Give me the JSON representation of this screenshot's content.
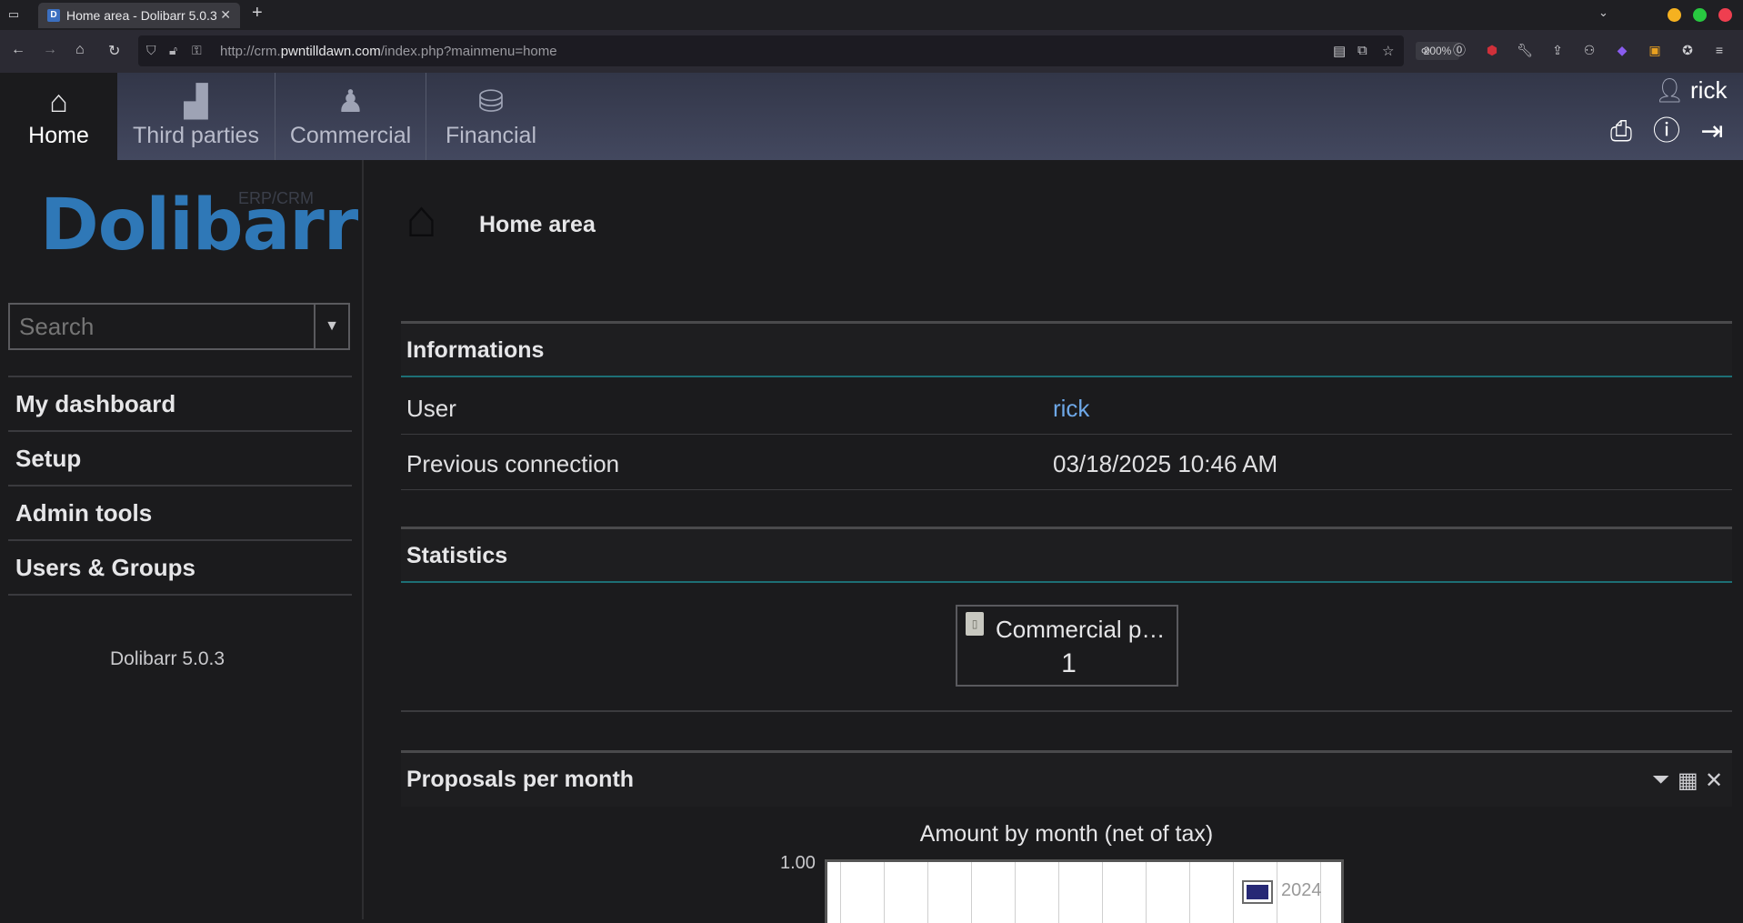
{
  "browser": {
    "tab_title": "Home area - Dolibarr 5.0.3",
    "tab_favicon": "D",
    "url_prefix": "http://crm.",
    "url_domain": "pwntilldawn.com",
    "url_path": "/index.php?mainmenu=home",
    "zoom": "200%"
  },
  "topmenu": {
    "items": [
      {
        "label": "Home",
        "icon": "home-icon"
      },
      {
        "label": "Third parties",
        "icon": "building-icon"
      },
      {
        "label": "Commercial",
        "icon": "salesman-icon"
      },
      {
        "label": "Financial",
        "icon": "coins-icon"
      }
    ],
    "username": "rick"
  },
  "sidebar": {
    "logo_small": "ERP/CRM",
    "logo_word": "Dolibarr",
    "search_placeholder": "Search",
    "items": [
      {
        "label": "My dashboard"
      },
      {
        "label": "Setup"
      },
      {
        "label": "Admin tools"
      },
      {
        "label": "Users & Groups"
      }
    ],
    "version": "Dolibarr 5.0.3"
  },
  "main": {
    "page_title": "Home area",
    "informations": {
      "title": "Informations",
      "rows": [
        {
          "key": "User",
          "value": "rick"
        },
        {
          "key": "Previous connection",
          "value": "03/18/2025 10:46 AM"
        }
      ]
    },
    "statistics": {
      "title": "Statistics",
      "box_label": "Commercial p…",
      "box_value": "1"
    },
    "proposals": {
      "title": "Proposals per month"
    }
  },
  "chart_data": {
    "type": "bar",
    "title": "Amount by month (net of tax)",
    "series": [
      {
        "name": "2024",
        "color": "#262875",
        "values": []
      }
    ],
    "ytick_labels": [
      "1.00"
    ]
  }
}
